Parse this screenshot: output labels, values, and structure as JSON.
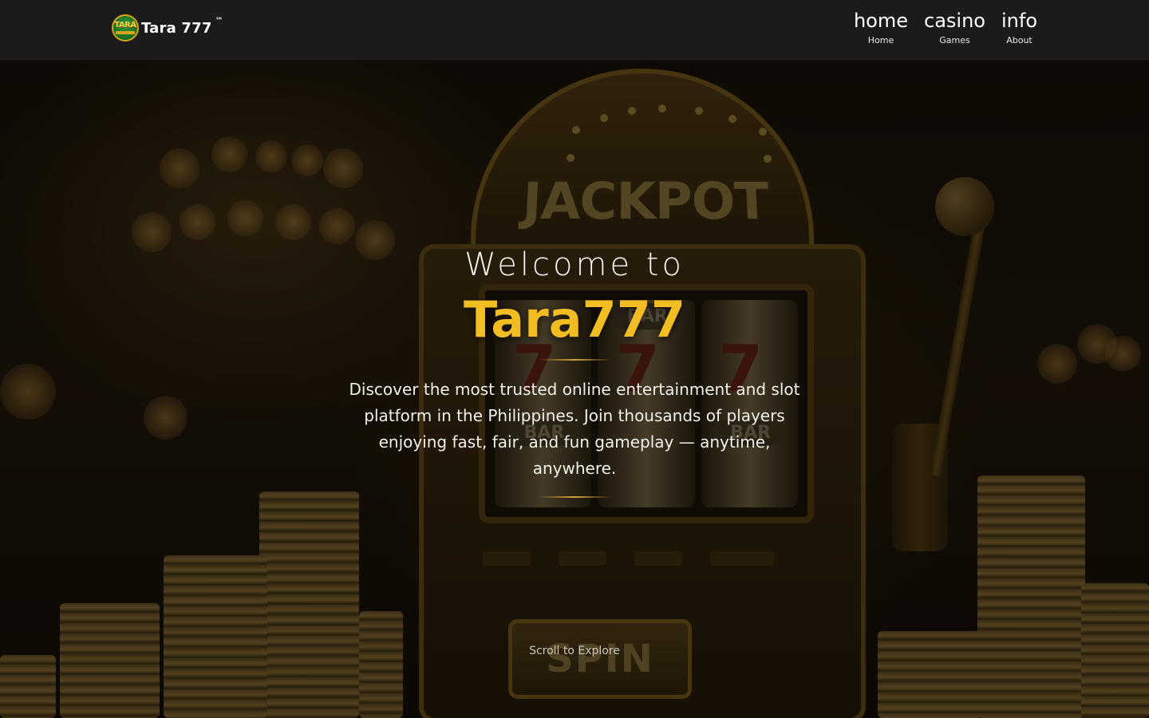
{
  "header": {
    "brand_badge_text": "TARA",
    "brand_name": "Tara 777",
    "brand_trademark": "™",
    "nav": [
      {
        "label": "home",
        "sublabel": "Home"
      },
      {
        "label": "casino",
        "sublabel": "Games"
      },
      {
        "label": "info",
        "sublabel": "About"
      }
    ]
  },
  "hero": {
    "welcome": "Welcome to",
    "title": "Tara777",
    "description": "Discover the most trusted online entertainment and slot platform in the Philippines. Join thousands of players enjoying fast, fair, and fun gameplay — anytime, anywhere.",
    "scroll_hint": "Scroll to Explore",
    "background_art": {
      "jackpot_text": "JACKPOT",
      "reel_bar_text": "BAR",
      "reel_seven_text": "7",
      "spin_text": "SPIN"
    }
  },
  "colors": {
    "header_bg": "#1b1b1b",
    "accent_gold": "#f2bd22",
    "text_light": "#f2f0ea"
  }
}
